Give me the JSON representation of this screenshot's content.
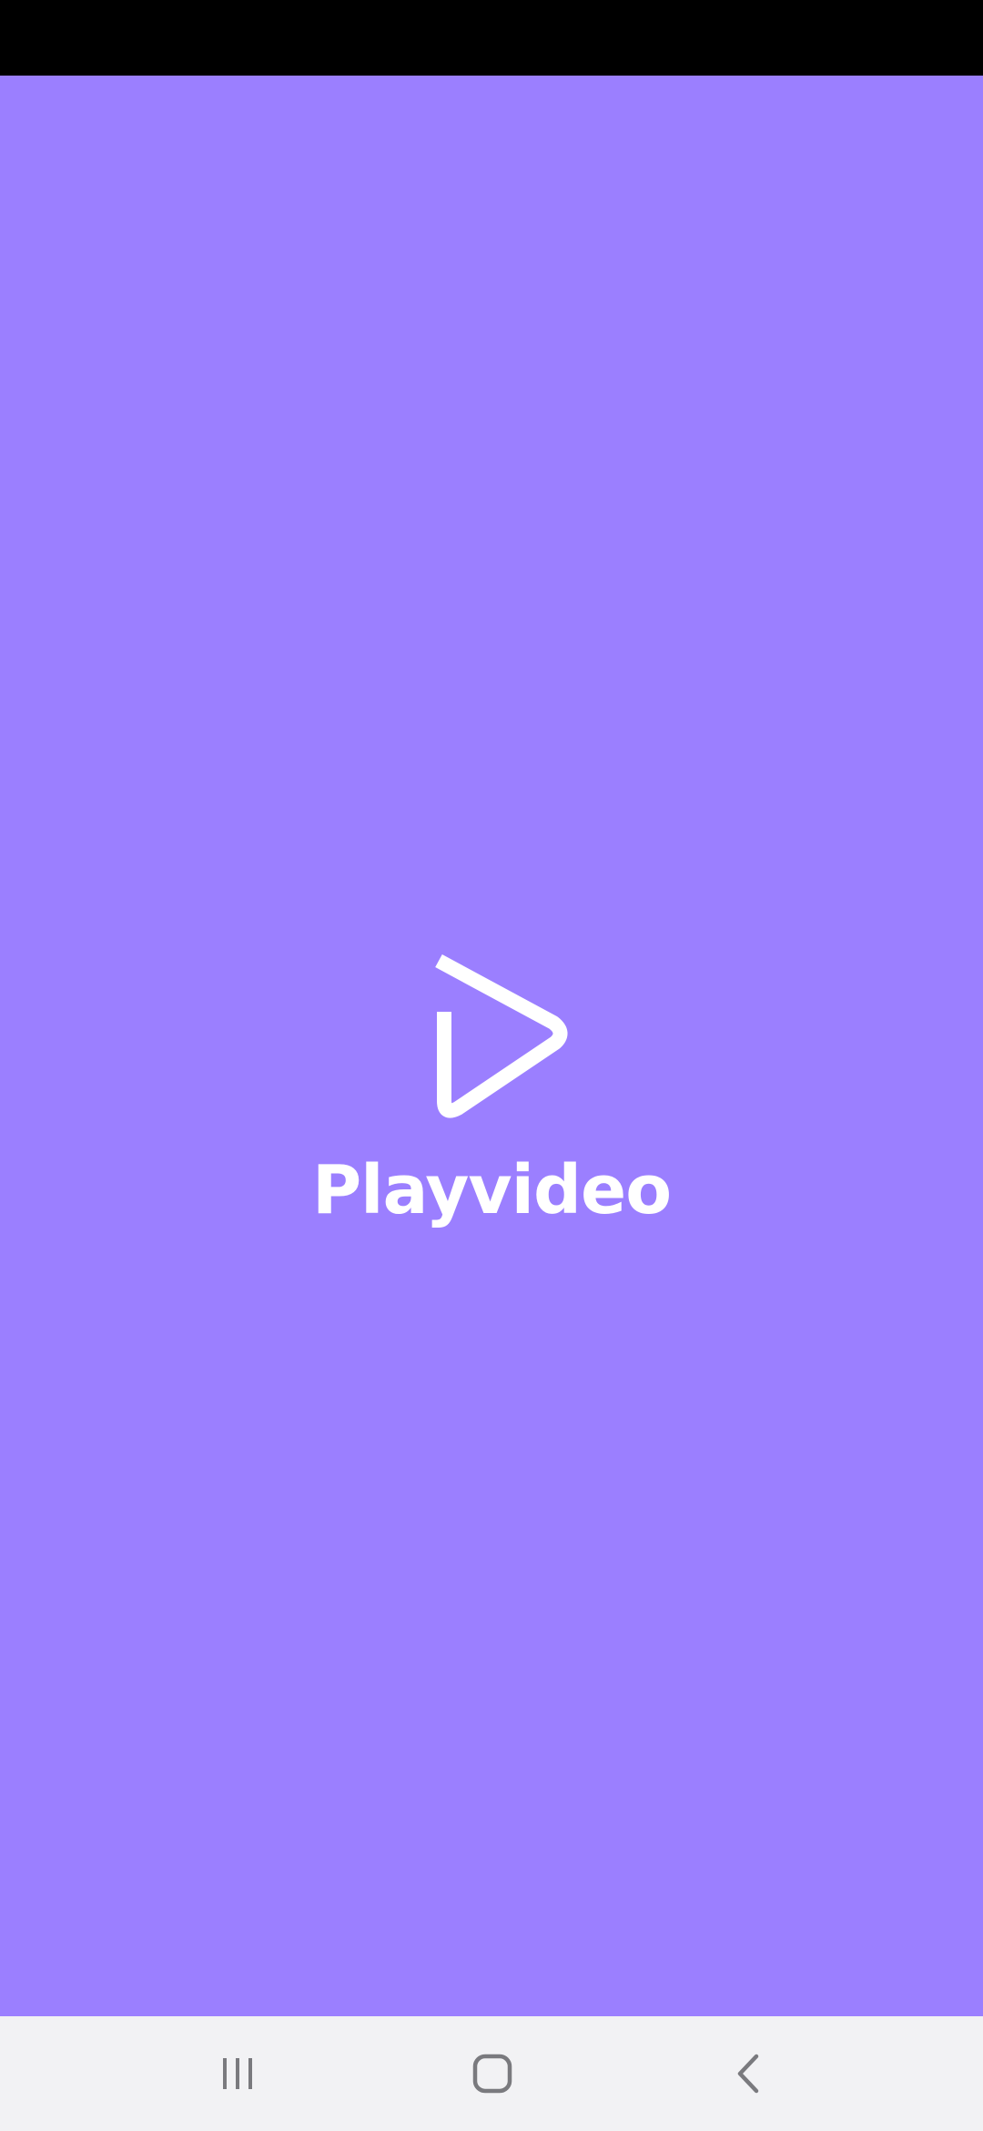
{
  "app": {
    "name": "Playvideo",
    "logo_icon": "play-triangle-outline-icon"
  },
  "colors": {
    "background": "#9b7fff",
    "status_bar": "#000000",
    "logo": "#ffffff",
    "nav_bar": "#f2f2f4",
    "nav_icons": "#7a7a7e"
  },
  "navigation_bar": {
    "buttons": [
      {
        "name": "recents",
        "icon": "recent-apps-icon"
      },
      {
        "name": "home",
        "icon": "home-icon"
      },
      {
        "name": "back",
        "icon": "back-chevron-icon"
      }
    ]
  }
}
